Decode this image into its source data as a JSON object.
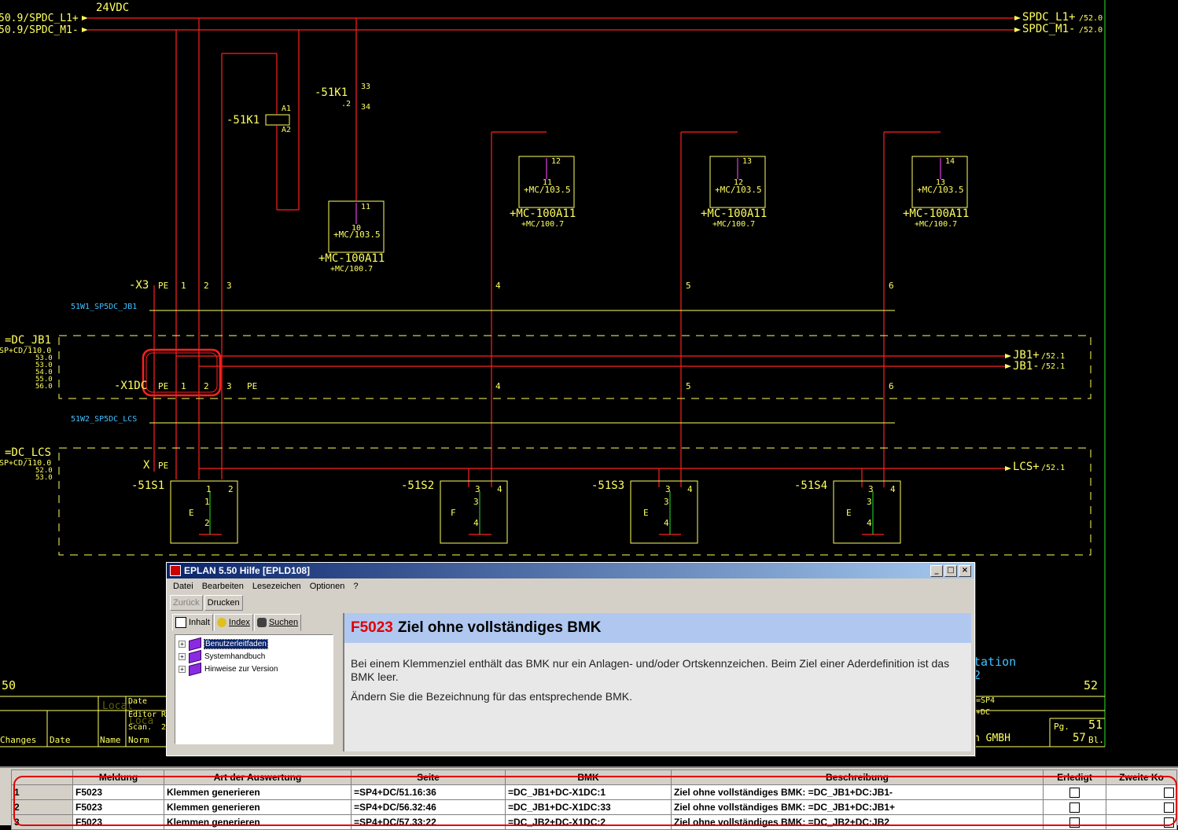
{
  "cad": {
    "voltage": "24VDC",
    "bus_left": [
      "50.9/SPDC_L1+",
      "50.9/SPDC_M1-"
    ],
    "bus_right": [
      "SPDC_L1+",
      "SPDC_M1-"
    ],
    "bus_right_refs": [
      "/52.0",
      "/52.0"
    ],
    "relay": "-51K1",
    "relay_contact": "-51K1",
    "relay_pins": [
      "A1",
      "A2"
    ],
    "contact_pins": [
      "33",
      "34",
      ".2"
    ],
    "devices": [
      {
        "top": "11",
        "bottom": "10",
        "label": "+MC/103.5",
        "name": "+MC-100A11",
        "sub": "+MC/100.7"
      },
      {
        "top": "12",
        "bottom": "11",
        "label": "+MC/103.5",
        "name": "+MC-100A11",
        "sub": "+MC/100.7"
      },
      {
        "top": "13",
        "bottom": "12",
        "label": "+MC/103.5",
        "name": "+MC-100A11",
        "sub": "+MC/100.7"
      },
      {
        "top": "14",
        "bottom": "13",
        "label": "+MC/103.5",
        "name": "+MC-100A11",
        "sub": "+MC/100.7"
      }
    ],
    "x3_label": "-X3",
    "x3_terminals": [
      "PE",
      "1",
      "2",
      "3",
      "4",
      "5",
      "6"
    ],
    "cable1": "51W1_SP5DC_JB1",
    "cable2": "51W2_SP5DC_LCS",
    "box1_name": "=DC_JB1",
    "box1_refs": [
      "SP+CD/110.0",
      "53.0",
      "53.0",
      "54.0",
      "55.0",
      "56.0"
    ],
    "x1dc_label": "-X1DC",
    "x1dc_terminals": [
      "PE",
      "1",
      "2",
      "3",
      "PE",
      "4",
      "5",
      "6"
    ],
    "jb_outputs": [
      "JB1+",
      "JB1-"
    ],
    "jb_refs": [
      "/52.1",
      "/52.1"
    ],
    "box2_name": "=DC_LCS",
    "box2_refs": [
      "SP+CD/110.0",
      "52.0",
      "53.0"
    ],
    "x_pe": "X",
    "x_pe_label": "PE",
    "lcs_output": "LCS+",
    "lcs_ref": "/52.1",
    "switches": [
      {
        "name": "-51S1",
        "pins": [
          "1",
          "2",
          "1",
          "2"
        ],
        "sym": "E"
      },
      {
        "name": "-51S2",
        "pins": [
          "3",
          "4",
          "3",
          "4"
        ],
        "sym": "F"
      },
      {
        "name": "-51S3",
        "pins": [
          "3",
          "4",
          "3",
          "4"
        ],
        "sym": "E"
      },
      {
        "name": "-51S4",
        "pins": [
          "3",
          "4",
          "3",
          "4"
        ],
        "sym": "E"
      }
    ],
    "page_left": "50",
    "page_right": "52",
    "footer_changes": "Changes",
    "footer_date": "Date",
    "footer_name": "Name",
    "footer_norm": "Norm",
    "footer_date2": "Date",
    "footer_editor": "Editor",
    "footer_scan": "Scan.",
    "footer_r": "R",
    "footer_2": "2",
    "footer_local": "Locat",
    "footer_local2": "Loca",
    "footer_station": "tation",
    "footer_station2": "2",
    "footer_sp4": "=SP4",
    "footer_dc": "+DC",
    "footer_gmbh": "n GMBH",
    "footer_pg": "Pg.",
    "footer_pg_num": "51",
    "footer_bl_num": "57",
    "footer_bl": "Bl."
  },
  "help": {
    "title": "EPLAN 5.50  Hilfe  [EPLD108]",
    "menu": [
      "Datei",
      "Bearbeiten",
      "Lesezeichen",
      "Optionen",
      "?"
    ],
    "toolbar": {
      "back": "Zurück",
      "print": "Drucken"
    },
    "tabs": [
      "Inhalt",
      "Index",
      "Suchen"
    ],
    "tree": [
      "Benutzerleitfaden",
      "Systemhandbuch",
      "Hinweise zur Version"
    ],
    "topic_code": "F5023",
    "topic_title": "Ziel ohne vollständiges BMK",
    "paragraph1": "Bei einem Klemmenziel enthält das BMK nur ein Anlagen- und/oder Ortskennzeichen. Beim Ziel einer Aderdefinition ist das BMK leer.",
    "paragraph2": "Ändern Sie die Bezeichnung für das entsprechende BMK."
  },
  "grid": {
    "columns": [
      "Meldung",
      "Art der Auswertung",
      "Seite",
      "BMK",
      "Beschreibung",
      "Erledigt",
      "Zweite Ko"
    ],
    "rows": [
      {
        "num": "1",
        "meldung": "F5023",
        "art": "Klemmen generieren",
        "seite": "=SP4+DC/51.16:36",
        "bmk": "=DC_JB1+DC-X1DC:1",
        "beschreibung": "Ziel ohne vollständiges BMK: =DC_JB1+DC:JB1-"
      },
      {
        "num": "2",
        "meldung": "F5023",
        "art": "Klemmen generieren",
        "seite": "=SP4+DC/56.32:46",
        "bmk": "=DC_JB1+DC-X1DC:33",
        "beschreibung": "Ziel ohne vollständiges BMK: =DC_JB1+DC:JB1+"
      },
      {
        "num": "3",
        "meldung": "F5023",
        "art": "Klemmen generieren",
        "seite": "=SP4+DC/57.33:22",
        "bmk": "=DC_JB2+DC-X1DC:2",
        "beschreibung": "Ziel ohne vollständiges BMK: =DC_JB2+DC:JB2"
      }
    ]
  },
  "colors": {
    "red": "#ff2020",
    "yellow": "#ffff60",
    "magenta": "#e040e0",
    "green": "#20c020",
    "cyan": "#40c0ff"
  }
}
